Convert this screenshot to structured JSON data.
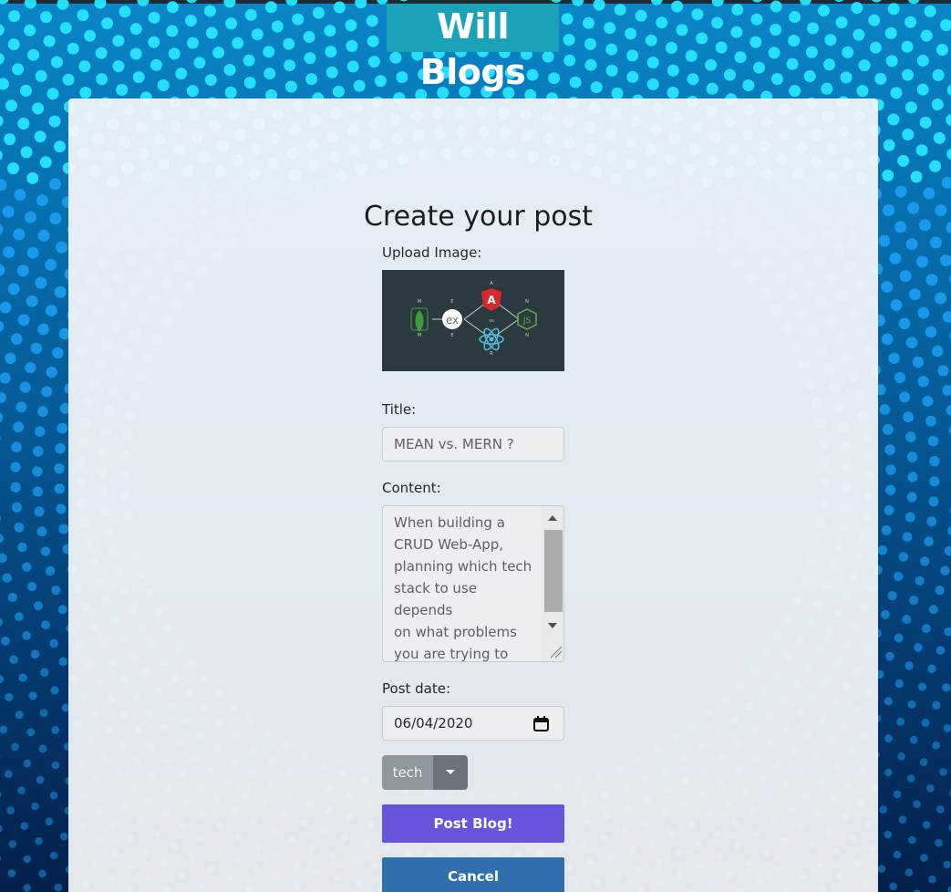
{
  "site": {
    "title": "Will Blogs"
  },
  "form": {
    "heading": "Create your post",
    "upload_label": "Upload Image:",
    "image": {
      "logo_letters": [
        "M",
        "E",
        "A",
        "N",
        "M",
        "E",
        "R",
        "N"
      ],
      "center_label": "vs",
      "express_label": "ex",
      "node_label": "JS"
    },
    "title_label": "Title:",
    "title_value": "MEAN vs. MERN ?",
    "content_label": "Content:",
    "content_value": "When building a\nCRUD Web-App,\nplanning which tech\nstack to use depends\non what problems\nyou are trying to\nsolve. for example:",
    "date_label": "Post date:",
    "date_value": "06/04/2020",
    "category_value": "tech",
    "post_button": "Post Blog!",
    "cancel_button": "Cancel"
  },
  "colors": {
    "background_top": "#0a86c8",
    "background_bottom": "#03204a",
    "title_bg": "#1aa3b8",
    "post_button": "#6654da",
    "cancel_button": "#2f6fae",
    "select_bg": "#8f969d"
  },
  "icons": {
    "calendar": "calendar-icon",
    "dropdown": "caret-down-icon",
    "scroll_up": "scroll-up-arrow-icon",
    "scroll_down": "scroll-down-arrow-icon",
    "resize": "resize-handle-icon"
  }
}
